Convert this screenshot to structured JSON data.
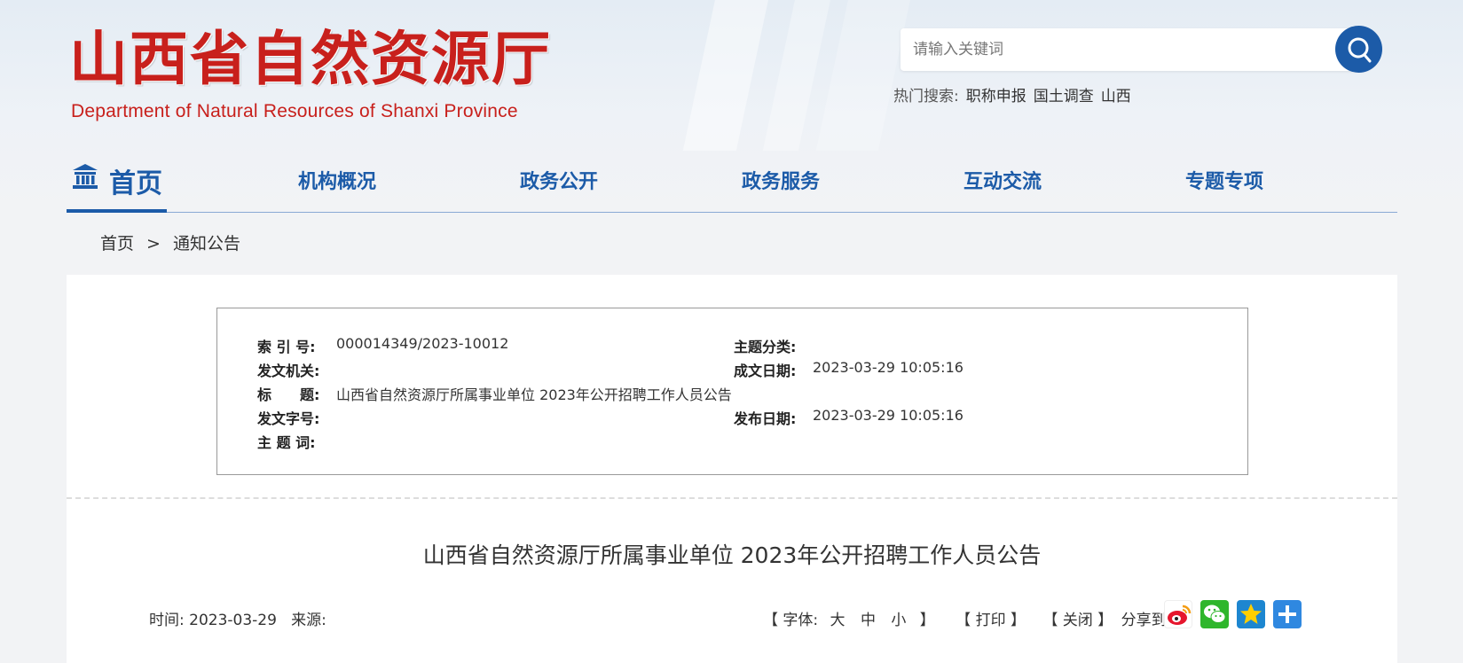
{
  "header": {
    "logo_cn": "山西省自然资源厅",
    "logo_en": "Department of Natural Resources of Shanxi Province",
    "search_placeholder": "请输入关键词",
    "hot_label": "热门搜索:",
    "hot_items": [
      "职称申报",
      "国土调查",
      "山西"
    ]
  },
  "nav": {
    "home": "首页",
    "items": [
      "机构概况",
      "政务公开",
      "政务服务",
      "互动交流",
      "专题专项"
    ]
  },
  "breadcrumb": {
    "items": [
      "首页",
      "通知公告"
    ],
    "separator": ">"
  },
  "meta": {
    "index_label": "索 引 号:",
    "index_value": "000014349/2023-10012",
    "topic_label": "主题分类:",
    "topic_value": "",
    "issuer_label": "发文机关:",
    "issuer_value": "",
    "created_label": "成文日期:",
    "created_value": "2023-03-29 10:05:16",
    "title_label": "标　　题:",
    "title_value": "山西省自然资源厅所属事业单位 2023年公开招聘工作人员公告",
    "docno_label": "发文字号:",
    "docno_value": "",
    "published_label": "发布日期:",
    "published_value": "2023-03-29 10:05:16",
    "keywords_label": "主 题 词:",
    "keywords_value": ""
  },
  "article": {
    "title": "山西省自然资源厅所属事业单位 2023年公开招聘工作人员公告",
    "time_label": "时间:",
    "time_value": "2023-03-29",
    "source_label": "来源:",
    "source_value": ""
  },
  "tools": {
    "font_open": "【 字体:",
    "font_large": "大",
    "font_medium": "中",
    "font_small": "小",
    "font_close": "】",
    "print": "【 打印 】",
    "close": "【 关闭 】",
    "share_label": "分享到",
    "share_icons": [
      "weibo-icon",
      "wechat-icon",
      "qzone-icon",
      "more-share-icon"
    ]
  },
  "colors": {
    "brand_red": "#c8201c",
    "brand_blue": "#1c5ba8"
  }
}
